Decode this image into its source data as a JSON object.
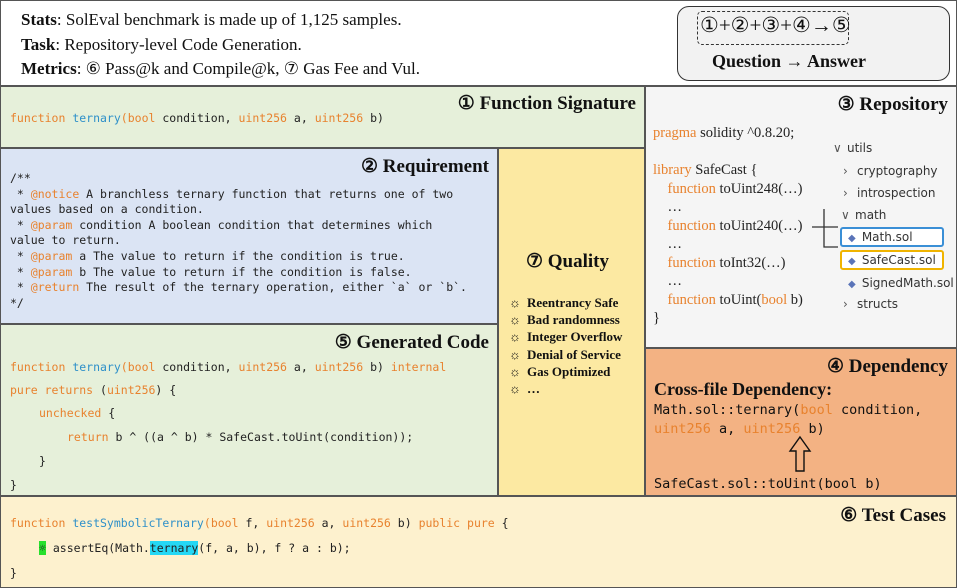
{
  "header": {
    "stats_label": "Stats",
    "stats_text": ": SolEval benchmark is made up of 1,125 samples.",
    "task_label": "Task",
    "task_text": ": Repository-level Code Generation.",
    "metrics_label": "Metrics",
    "metrics_text": ": ⑥ Pass@k and Compile@k, ⑦ Gas Fee and Vul."
  },
  "qa": {
    "formula": "①+②+③+④",
    "arrow_result": "→⑤",
    "question": "Question",
    "arrow": "→",
    "answer": "Answer"
  },
  "signature": {
    "title": "① Function Signature",
    "code": {
      "kw1": "function ",
      "name": "ternary",
      "p1": "(",
      "t1": "bool",
      "a1": " condition, ",
      "t2": "uint256",
      "a2": " a, ",
      "t3": "uint256",
      "a3": " b)"
    }
  },
  "requirement": {
    "title": "② Requirement",
    "lines": [
      {
        "pre": "/**",
        "tag": "",
        "post": ""
      },
      {
        "pre": " * ",
        "tag": "@notice",
        "post": " A branchless ternary function that returns one of two"
      },
      {
        "pre": "values based on a condition.",
        "tag": "",
        "post": ""
      },
      {
        "pre": " * ",
        "tag": "@param",
        "post": " condition A boolean condition that determines which"
      },
      {
        "pre": "value to return.",
        "tag": "",
        "post": ""
      },
      {
        "pre": " * ",
        "tag": "@param",
        "post": " a The value to return if the condition is true."
      },
      {
        "pre": " * ",
        "tag": "@param",
        "post": " b The value to return if the condition is false."
      },
      {
        "pre": " * ",
        "tag": "@return",
        "post": " The result of the ternary operation, either `a` or `b`."
      },
      {
        "pre": "*/",
        "tag": "",
        "post": ""
      }
    ]
  },
  "generated": {
    "title": "⑤ Generated Code",
    "l1": {
      "kw": "function ",
      "name": "ternary",
      "p": "(",
      "t1": "bool",
      "a1": " condition, ",
      "t2": "uint256",
      "a2": " a, ",
      "t3": "uint256",
      "a3": " b) ",
      "kw2": "internal"
    },
    "l2": {
      "kw": "pure returns",
      "rest": " (",
      "t": "uint256",
      "end": ") {"
    },
    "l3": {
      "kw": "unchecked",
      "rest": " {"
    },
    "l4": {
      "kw": "return",
      "rest": " b ^ ((a ^ b) * SafeCast.toUint(condition));"
    },
    "l5": "}",
    "l6": "}"
  },
  "quality": {
    "title": "⑦ Quality",
    "gear": "☼",
    "items": [
      "Reentrancy Safe",
      "Bad randomness",
      "Integer Overflow",
      "Denial of Service",
      "Gas Optimized",
      "…"
    ]
  },
  "repository": {
    "title": "③ Repository",
    "code": [
      {
        "kw": "pragma",
        "rest": " solidity ^0.8.20;"
      },
      {
        "kw": "",
        "rest": ""
      },
      {
        "kw": "library",
        "rest": " SafeCast {"
      },
      {
        "kw": "    function",
        "rest": " toUint248(…)"
      },
      {
        "kw": "",
        "rest": "    …"
      },
      {
        "kw": "    function",
        "rest": " toUint240(…)"
      },
      {
        "kw": "",
        "rest": "    …"
      },
      {
        "kw": "    function",
        "rest": " toInt32(…)"
      },
      {
        "kw": "",
        "rest": "    …"
      },
      {
        "kw": "    function",
        "rest": " toUint(",
        "kw2": "bool",
        "rest2": " b)"
      },
      {
        "kw": "",
        "rest": "}"
      }
    ],
    "tree": {
      "utils": "utils",
      "cryptography": "cryptography",
      "introspection": "introspection",
      "math": "math",
      "math_sol": "Math.sol",
      "safecast_sol": "SafeCast.sol",
      "signedmath_sol": "SignedMath.sol",
      "structs": "structs"
    },
    "colors": {
      "math_border": "#3a8fd6",
      "safecast_border": "#f0b400"
    }
  },
  "dependency": {
    "title": "④ Dependency",
    "subtitle": "Cross-file Dependency:",
    "l1a": "Math.sol::ternary(",
    "l1kw": "bool",
    "l1b": " condition,",
    "l2kw1": "uint256",
    "l2a": " a, ",
    "l2kw2": "uint256",
    "l2b": " b)",
    "l3": "SafeCast.sol::toUint(bool b)"
  },
  "tests": {
    "title": "⑥ Test Cases",
    "l1": {
      "kw": "function ",
      "name": "testSymbolicTernary",
      "p": "(",
      "t1": "bool",
      "a1": " f, ",
      "t2": "uint256",
      "a2": " a, ",
      "t3": "uint256",
      "a3": " b) ",
      "kw2": "public pure",
      "end": " {"
    },
    "l2": {
      "mark": "☼",
      "pre": " assertEq(Math.",
      "hl": "ternary",
      "post": "(f, a, b), f ? a : b);"
    },
    "l3": "}"
  }
}
